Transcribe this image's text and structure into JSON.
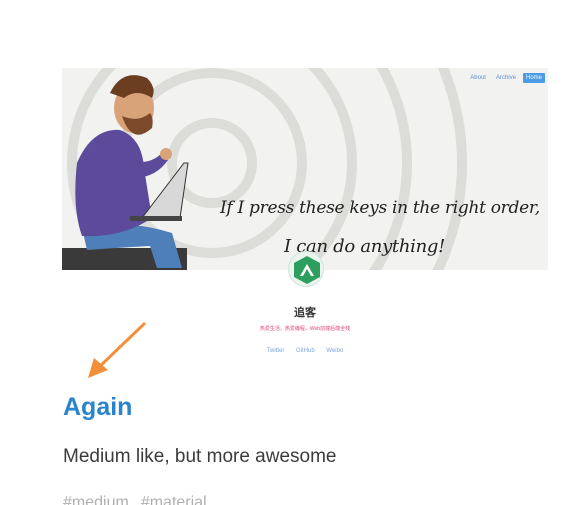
{
  "preview": {
    "nav": [
      "About",
      "Archive",
      "Home"
    ],
    "motto_line1": "If I press these keys in the right order,",
    "motto_line2": "I can do anything!",
    "site_name": "追客",
    "site_desc": "热爱生活，热爱编程，Web前端后端全栈",
    "links": [
      "Twitter",
      "GitHub",
      "Weibo"
    ]
  },
  "card": {
    "title": "Again",
    "subtitle": "Medium like, but more awesome",
    "tags": [
      "#medium",
      "#material"
    ]
  },
  "colors": {
    "title": "#2a84cc",
    "arrow": "#f2903a",
    "nav_active": "#4b9be6",
    "desc": "#e0457b"
  },
  "icons": [
    "arrow-icon",
    "avatar-logo"
  ]
}
